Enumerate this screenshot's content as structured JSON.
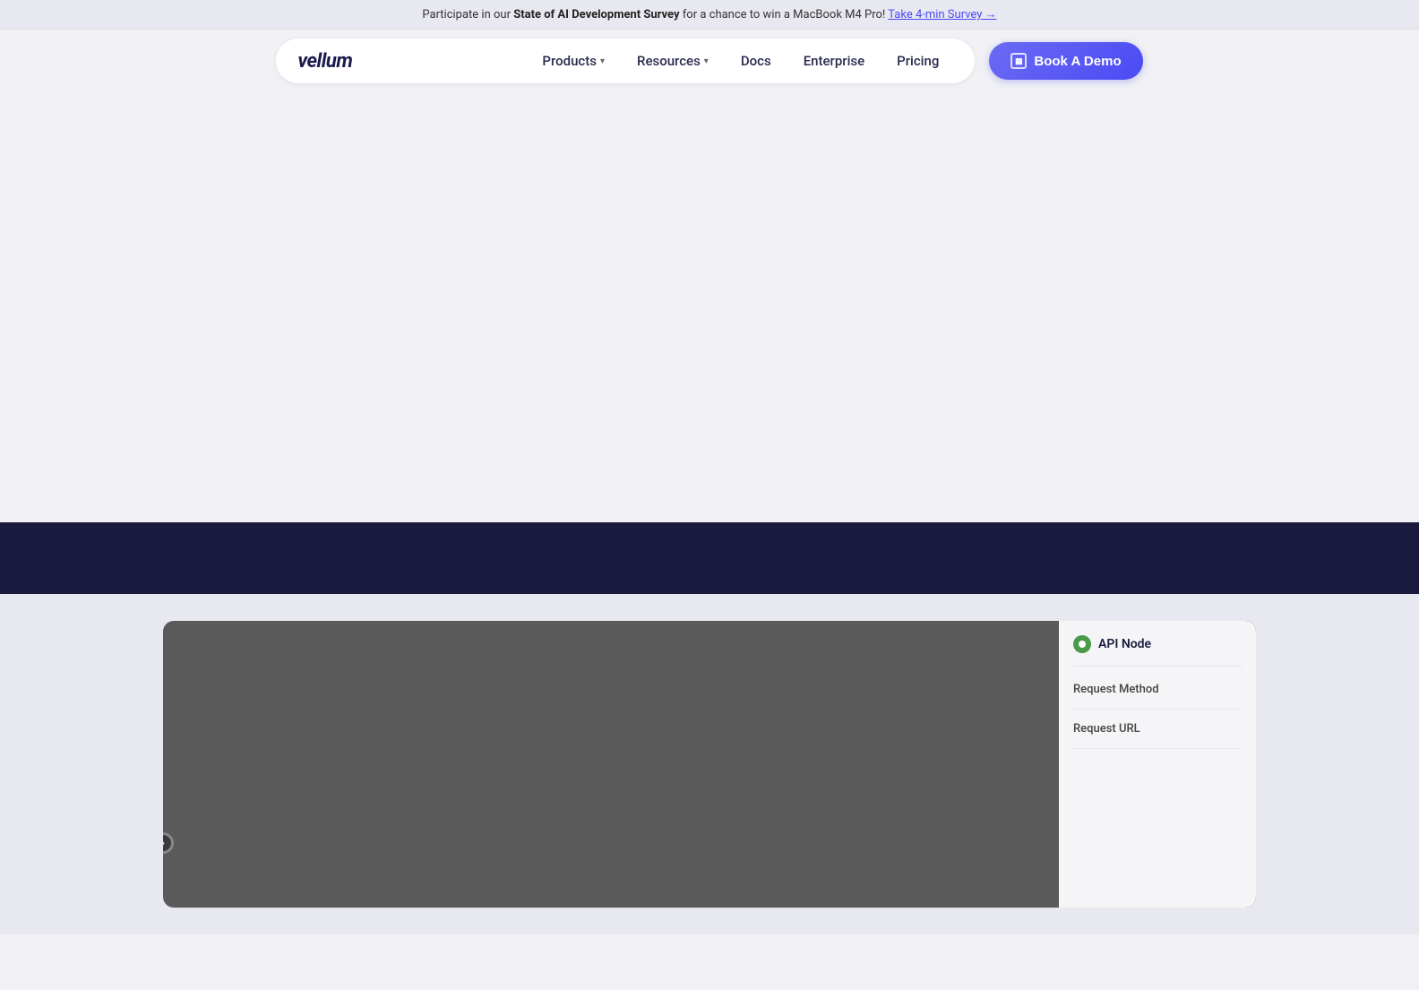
{
  "announcement": {
    "prefix": "Participate in our ",
    "bold": "State of AI Development Survey",
    "suffix": " for a chance to win a MacBook M4 Pro!",
    "link_text": "Take 4-min Survey →"
  },
  "nav": {
    "logo": "vellum",
    "items": [
      {
        "label": "Products",
        "has_dropdown": true
      },
      {
        "label": "Resources",
        "has_dropdown": true
      },
      {
        "label": "Docs",
        "has_dropdown": false
      },
      {
        "label": "Enterprise",
        "has_dropdown": false
      },
      {
        "label": "Pricing",
        "has_dropdown": false
      }
    ],
    "cta": {
      "label": "Book A Demo",
      "icon": "calendar-icon"
    }
  },
  "api_node_panel": {
    "title": "API Node",
    "fields": [
      {
        "label": "Request Method"
      },
      {
        "label": "Request URL"
      }
    ]
  }
}
